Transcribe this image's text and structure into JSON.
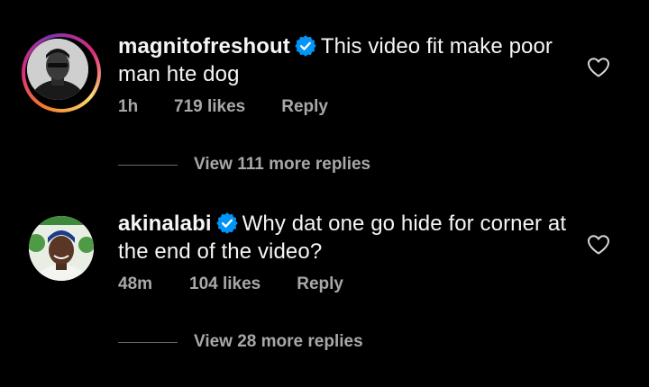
{
  "comments": [
    {
      "username": "magnitofreshout",
      "verified": true,
      "text": "This video fit make poor man hte dog",
      "time": "1h",
      "likes": "719 likes",
      "reply_label": "Reply",
      "view_replies": "View 111 more replies",
      "avatar_ring": true
    },
    {
      "username": "akinalabi",
      "verified": true,
      "text": "Why dat one go hide for corner at the end of the video?",
      "time": "48m",
      "likes": "104 likes",
      "reply_label": "Reply",
      "view_replies": "View 28 more replies",
      "avatar_ring": false
    }
  ],
  "colors": {
    "background": "#000000",
    "primary_text": "#f5f5f5",
    "secondary_text": "#a8a8a8",
    "verified_badge": "#0095f6"
  },
  "icons": {
    "verified": "verified-badge-icon",
    "like": "heart-outline-icon"
  }
}
